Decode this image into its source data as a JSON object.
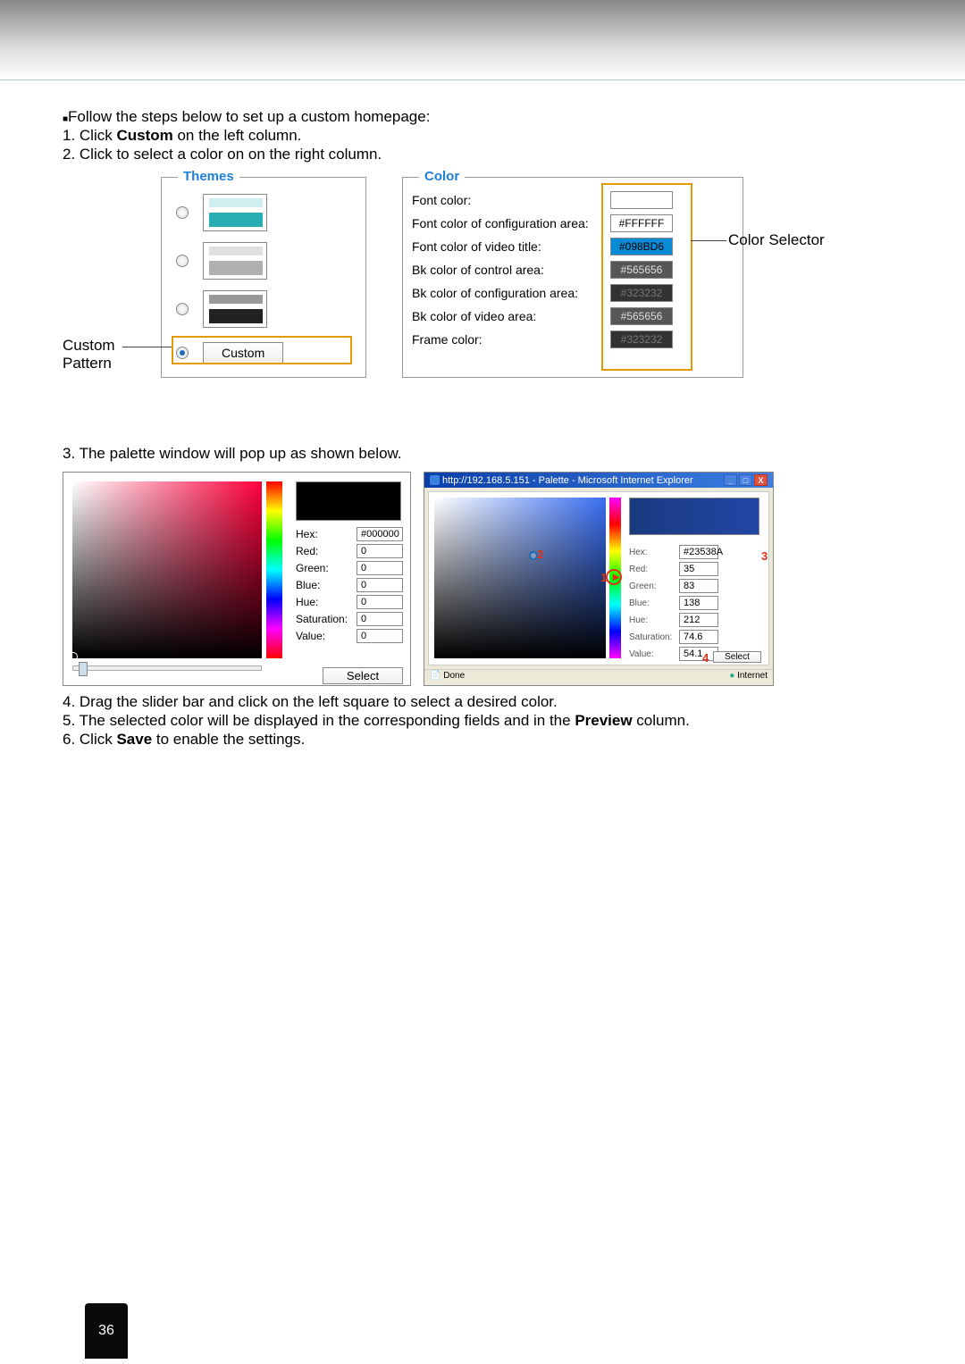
{
  "intro": {
    "bullet": "Follow the steps below to set up a custom homepage:",
    "step1_pre": "1. Click ",
    "step1_bold": "Custom",
    "step1_post": " on the left column.",
    "step2": "2. Click to select a color on on the right column."
  },
  "themes": {
    "legend": "Themes",
    "custom_btn": "Custom"
  },
  "labels": {
    "custom_pattern_line1": "Custom",
    "custom_pattern_line2": "Pattern",
    "color_selector": "Color Selector"
  },
  "color_panel": {
    "legend": "Color",
    "rows": [
      {
        "label": "Font color:",
        "hex": "",
        "bg": "#ffffff",
        "fg": "#000"
      },
      {
        "label": "Font color of configuration area:",
        "hex": "#FFFFFF",
        "bg": "#ffffff",
        "fg": "#000"
      },
      {
        "label": "Font color of video title:",
        "hex": "#098BD6",
        "bg": "#098BD6",
        "fg": "#000"
      },
      {
        "label": "Bk color of control area:",
        "hex": "#565656",
        "bg": "#565656",
        "fg": "#ddd"
      },
      {
        "label": "Bk color of configuration area:",
        "hex": "#323232",
        "bg": "#323232",
        "fg": "#777"
      },
      {
        "label": "Bk color of video area:",
        "hex": "#565656",
        "bg": "#565656",
        "fg": "#ddd"
      },
      {
        "label": "Frame color:",
        "hex": "#323232",
        "bg": "#323232",
        "fg": "#777"
      }
    ]
  },
  "palette_intro": "3. The palette window will pop up as shown below.",
  "palette1": {
    "fields": {
      "Hex": "#000000",
      "Red": "0",
      "Green": "0",
      "Blue": "0",
      "Hue": "0",
      "Saturation": "0",
      "Value": "0"
    },
    "select": "Select"
  },
  "palette2": {
    "title": "http://192.168.5.151 - Palette - Microsoft Internet Explorer",
    "fields": {
      "Hex": "#23538A",
      "Red": "35",
      "Green": "83",
      "Blue": "138",
      "Hue": "212",
      "Saturation": "74.6",
      "Value": "54.1"
    },
    "select": "Select",
    "status_done": "Done",
    "status_net": "Internet",
    "nums": {
      "n1": "1",
      "n2": "2",
      "n3": "3",
      "n4": "4"
    }
  },
  "after": {
    "s4": "4. Drag the slider bar and click on the left square to select a desired color.",
    "s5_pre": "5. The selected color will be displayed in the corresponding fields and in the ",
    "s5_bold": "Preview",
    "s5_post": " column.",
    "s6_pre": "6. Click ",
    "s6_bold": "Save",
    "s6_post": " to enable the settings."
  },
  "page_number": "36"
}
